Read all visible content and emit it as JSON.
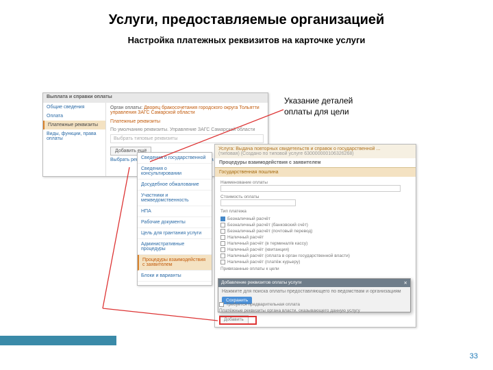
{
  "slide": {
    "title": "Услуги, предоставляемые организацией",
    "subtitle": "Настройка платежных реквизитов на карточке услуги",
    "callout_l1": "Указание деталей",
    "callout_l2": "оплаты для цели",
    "page": "33"
  },
  "shot1": {
    "header": "Выплата и справки оплаты",
    "side": {
      "i1": "Общие сведения",
      "i2": "Оплата",
      "i3": "Платежные реквизиты",
      "i4": "Виды, функции, права оплаты"
    },
    "org_label": "Орган оплаты:",
    "org_value": "Дворец бракосочетания городского округа Тольятти управления ЗАГС Самарской области",
    "section": "Платежные реквизиты",
    "note": "По умолчанию реквизиты. Управление ЗАГС Самарской области",
    "dots": "Выбрать типовые реквизиты",
    "btn": "Добавить ещё",
    "sublink": "Выбрать реквизиты вышестоящего ведомства"
  },
  "shot2": {
    "i1": "Сведения о государственной",
    "i2": "Сведения о консультировании",
    "i3": "Досудебное обжалование",
    "i4": "Участники и межведомственность",
    "i5": "НПА",
    "i6": "Рабочие документы",
    "i7": "Цель для грантания услуги",
    "i8": "Административные процедуры",
    "i9": "Процедуры взаимодействия с заявителем",
    "i10": "Блоки и варианты"
  },
  "shot3": {
    "title_line1": "Услуга: Выдача повторных свидетельств и справок о государственной ...",
    "title_line2": "(типовая) (Создано по типовой услуге 630000000106326268)",
    "section_title": "Процедуры взаимодействия с заявителем",
    "tag": "Государственная пошлина",
    "f_name": "Наименование оплаты",
    "f_cost": "Стоимость оплаты",
    "f_type": "Тип платежа",
    "chk1": "Безналичный расчёт",
    "chk2": "Безналичный расчёт (банковский счёт)",
    "chk3": "Безналичный расчёт (почтовый перевод)",
    "chk4": "Наличный расчёт",
    "chk5": "Наличный расчёт (в терминал/в кассу)",
    "chk6": "Наличный расчёт (квитанция)",
    "chk7": "Наличный расчёт (оплата в орган государственной власти)",
    "chk8": "Наличный расчёт (платёж курьеру)",
    "lbl_bound": "Привязанные оплаты к цели",
    "popup_title": "Добавление реквизитов оплаты услуги",
    "popup_body": "Нажмите для поиска оплаты предоставляющего по ведомствам и организациям",
    "popup_btn": "Сохранить",
    "chk_bottom": "Требуется предварительная оплата",
    "note_bottom1": "Платёжные реквизиты органа власти, оказывающего данную услугу",
    "btn_bottom": "Добавить"
  }
}
